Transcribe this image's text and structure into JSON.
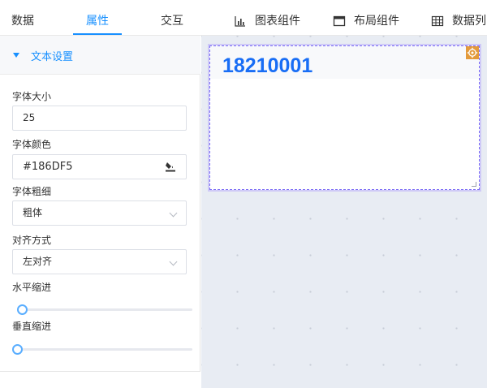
{
  "tabs": [
    {
      "label": "数据"
    },
    {
      "label": "属性",
      "active": true
    },
    {
      "label": "交互"
    }
  ],
  "tools": [
    {
      "icon": "bar-chart-icon",
      "label": "图表组件"
    },
    {
      "icon": "layout-window-icon",
      "label": "布局组件"
    },
    {
      "icon": "table-grid-icon",
      "label": "数据列"
    }
  ],
  "panel": {
    "section_title": "文本设置",
    "font_size": {
      "label": "字体大小",
      "value": "25"
    },
    "font_color": {
      "label": "字体颜色",
      "value": "#186DF5"
    },
    "font_weight": {
      "label": "字体粗细",
      "value": "粗体"
    },
    "align": {
      "label": "对齐方式",
      "value": "左对齐"
    },
    "h_indent": {
      "label": "水平缩进",
      "value": 0
    },
    "v_indent": {
      "label": "垂直缩进",
      "value": 0
    }
  },
  "widget": {
    "text": "18210001",
    "text_color": "#186DF5"
  },
  "colors": {
    "accent": "#1890ff",
    "text_color": "#186DF5",
    "gear": "#e39a3b"
  }
}
